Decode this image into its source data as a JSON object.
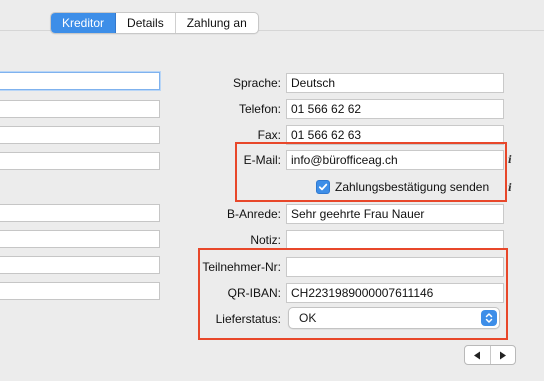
{
  "tabs": [
    {
      "label": "Kreditor",
      "active": true
    },
    {
      "label": "Details",
      "active": false
    },
    {
      "label": "Zahlung an",
      "active": false
    }
  ],
  "form": {
    "sprache": {
      "label": "Sprache:",
      "value": "Deutsch"
    },
    "telefon": {
      "label": "Telefon:",
      "value": "01  566 62 62"
    },
    "fax": {
      "label": "Fax:",
      "value": "01  566 62 63"
    },
    "email": {
      "label": "E-Mail:",
      "value": "info@bürofficeag.ch"
    },
    "zahlungsbestaetigung": {
      "label": "Zahlungsbestätigung senden",
      "checked": true
    },
    "b_anrede": {
      "label": "B-Anrede:",
      "value": "Sehr geehrte Frau Nauer"
    },
    "notiz": {
      "label": "Notiz:",
      "value": ""
    },
    "teilnehmer_nr": {
      "label": "Teilnehmer-Nr:",
      "value": ""
    },
    "qr_iban": {
      "label": "QR-IBAN:",
      "value": "CH2231989000007611146"
    },
    "lieferstatus": {
      "label": "Lieferstatus:",
      "value": "OK"
    }
  },
  "info_glyph": "i",
  "icons": {
    "nav_prev": "triangle-left-icon",
    "nav_next": "triangle-right-icon",
    "select": "chevron-up-down-icon",
    "info": "info-icon"
  },
  "colors": {
    "accent": "#3d8ee8",
    "highlight": "#e8472a"
  }
}
